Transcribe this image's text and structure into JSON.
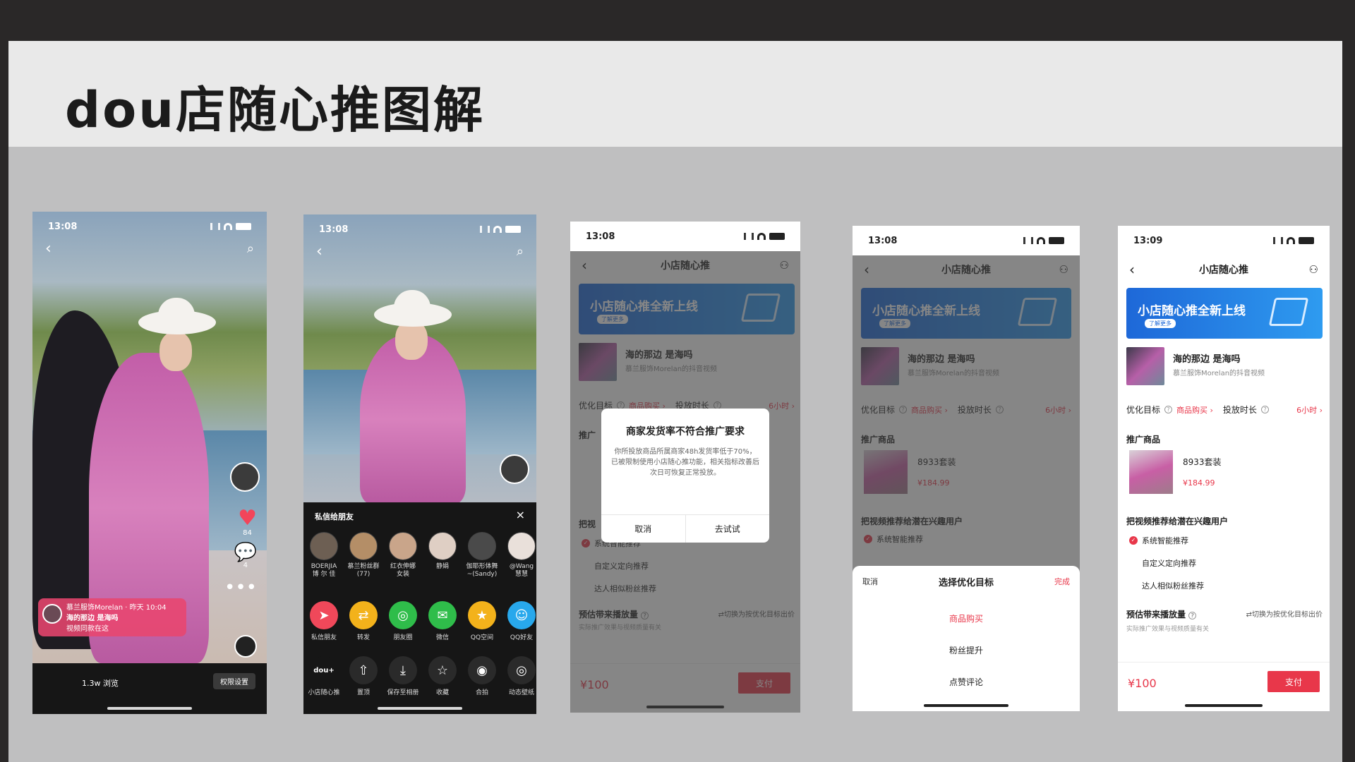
{
  "slide": {
    "title": "dou店随心推图解"
  },
  "status_bar": {
    "time_1": "13:08",
    "time_2": "13:08",
    "time_3": "13:08",
    "time_4": "13:08",
    "time_5": "13:09"
  },
  "video": {
    "likes": "84",
    "comments": "4",
    "promo_author": "慕兰服饰Morelan · 昨天 10:04",
    "promo_title": "海的那边 是海吗",
    "promo_link": "视频同款在这",
    "views": "1.3w 浏览",
    "permission_button": "权限设置"
  },
  "share_panel": {
    "title": "私信给朋友",
    "close": "×",
    "friends": [
      "BOERJIA 博 尔 佳",
      "慕兰粉丝群 (77)",
      "红衣伸娜 女装",
      "静娟",
      "伽耶形体舞~(Sandy)",
      "@Wang 慧慧"
    ],
    "apps": [
      {
        "label": "私信朋友",
        "color": "#f0485a",
        "glyph": "➤"
      },
      {
        "label": "转发",
        "color": "#f3b21b",
        "glyph": "⇄"
      },
      {
        "label": "朋友圈",
        "color": "#2fbd4a",
        "glyph": "◎"
      },
      {
        "label": "微信",
        "color": "#2fbd4a",
        "glyph": "✉"
      },
      {
        "label": "QQ空间",
        "color": "#f3b21b",
        "glyph": "★"
      },
      {
        "label": "QQ好友",
        "color": "#28a8ec",
        "glyph": "☺"
      }
    ],
    "tools": [
      {
        "label": "小店随心推",
        "glyph": "dou+"
      },
      {
        "label": "置顶",
        "glyph": "⇧"
      },
      {
        "label": "保存至相册",
        "glyph": "⤓"
      },
      {
        "label": "收藏",
        "glyph": "☆"
      },
      {
        "label": "合拍",
        "glyph": "◉"
      },
      {
        "label": "动态壁纸",
        "glyph": "◎"
      }
    ]
  },
  "app": {
    "nav_title": "小店随心推",
    "banner_title": "小店随心推全新上线",
    "banner_button": "了解更多",
    "video_title": "海的那边 是海吗",
    "video_sub": "慕兰服饰Morelan的抖音视频",
    "opt_label": "优化目标",
    "opt_value": "商品购买 ›",
    "duration_label": "投放时长",
    "duration_value": "6小时 ›",
    "goods_section": "推广商品",
    "goods_section_short": "推广",
    "goods_name": "8933套装",
    "goods_price": "¥184.99",
    "push_section": "把视频推荐给潜在兴趣用户",
    "push_section_short": "把视",
    "radio_1": "系统智能推荐",
    "radio_2": "自定义定向推荐",
    "radio_3": "达人相似粉丝推荐",
    "est_label": "预估带来播放量",
    "est_switch": "⇄切换为按优化目标出价",
    "est_sub": "实际推广效果与视频质量有关",
    "price": "¥100",
    "pay": "支付"
  },
  "dialog": {
    "title": "商家发货率不符合推广要求",
    "body": "你所投放商品所属商家48h发货率低于70%，已被限制使用小店随心推功能，相关指标改善后次日可恢复正常投放。",
    "cancel": "取消",
    "try": "去试试"
  },
  "sheet": {
    "cancel": "取消",
    "title": "选择优化目标",
    "done": "完成",
    "options": [
      "商品购买",
      "粉丝提升",
      "点赞评论"
    ]
  }
}
